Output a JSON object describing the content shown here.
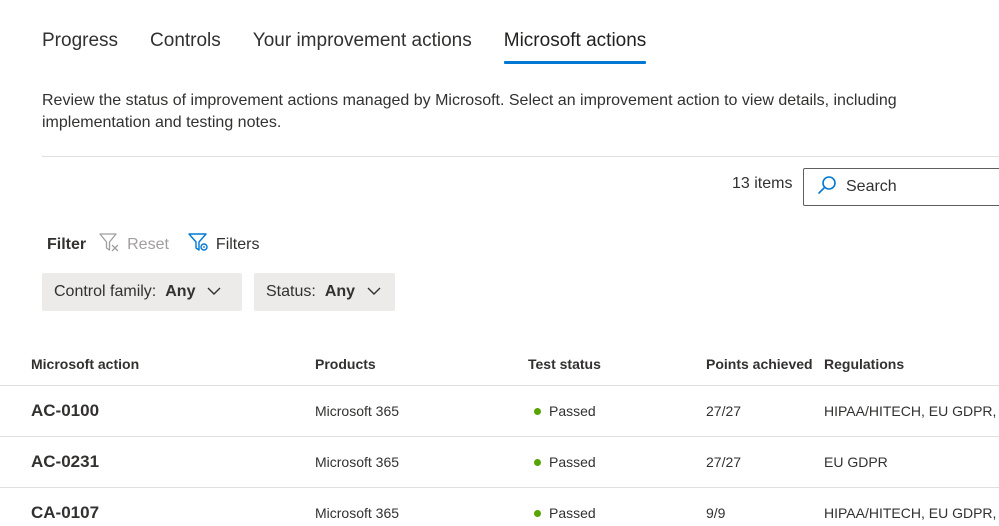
{
  "tabs": [
    {
      "label": "Progress"
    },
    {
      "label": "Controls"
    },
    {
      "label": "Your improvement actions"
    },
    {
      "label": "Microsoft actions"
    }
  ],
  "active_tab": "Microsoft actions",
  "description": "Review the status of improvement actions managed by Microsoft. Select an improvement action to view details, including implementation and testing notes.",
  "toolbar": {
    "item_count": "13 items",
    "search_placeholder": "Search"
  },
  "filter": {
    "label": "Filter",
    "reset_label": "Reset",
    "filters_label": "Filters",
    "pills": [
      {
        "label": "Control family:",
        "value": "Any"
      },
      {
        "label": "Status:",
        "value": "Any"
      }
    ]
  },
  "table": {
    "columns": [
      "Microsoft action",
      "Products",
      "Test status",
      "Points achieved",
      "Regulations"
    ],
    "rows": [
      {
        "action": "AC-0100",
        "product": "Microsoft 365",
        "status": "Passed",
        "points": "27/27",
        "regulations": "HIPAA/HITECH, EU GDPR, DA"
      },
      {
        "action": "AC-0231",
        "product": "Microsoft 365",
        "status": "Passed",
        "points": "27/27",
        "regulations": "EU GDPR"
      },
      {
        "action": "CA-0107",
        "product": "Microsoft 365",
        "status": "Passed",
        "points": "9/9",
        "regulations": "HIPAA/HITECH, EU GDPR, DA"
      }
    ]
  },
  "colors": {
    "accent": "#0078d4",
    "passed": "#57a300",
    "pill_bg": "#edebe9"
  },
  "icons": {
    "search": "search-icon",
    "reset": "filter-clear-icon",
    "filters": "filter-settings-icon",
    "dropdown": "chevron-down-icon"
  }
}
